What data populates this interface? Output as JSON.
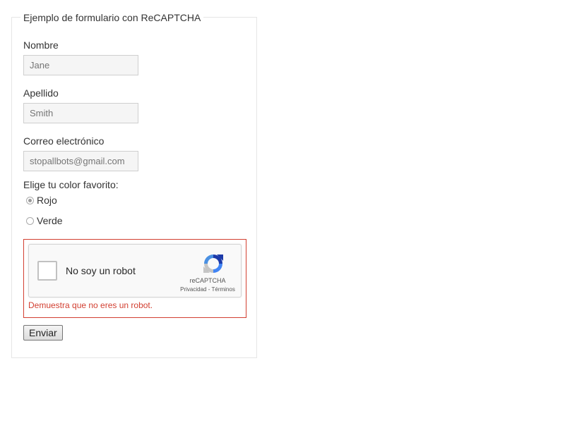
{
  "form": {
    "legend": "Ejemplo de formulario con ReCAPTCHA",
    "fields": [
      {
        "label": "Nombre",
        "placeholder": "Jane"
      },
      {
        "label": "Apellido",
        "placeholder": "Smith"
      },
      {
        "label": "Correo electrónico",
        "placeholder": "stopallbots@gmail.com"
      }
    ],
    "color_question": "Elige tu color favorito:",
    "color_options": [
      {
        "label": "Rojo",
        "checked": true
      },
      {
        "label": "Verde",
        "checked": false
      }
    ],
    "submit_label": "Enviar"
  },
  "recaptcha": {
    "checkbox_label": "No soy un robot",
    "brand": "reCAPTCHA",
    "privacy_label": "Privacidad",
    "separator": " - ",
    "terms_label": "Términos",
    "error_message": "Demuestra que no eres un robot.",
    "error_color": "#d23f31",
    "logo_icon": "recaptcha-logo-icon"
  }
}
